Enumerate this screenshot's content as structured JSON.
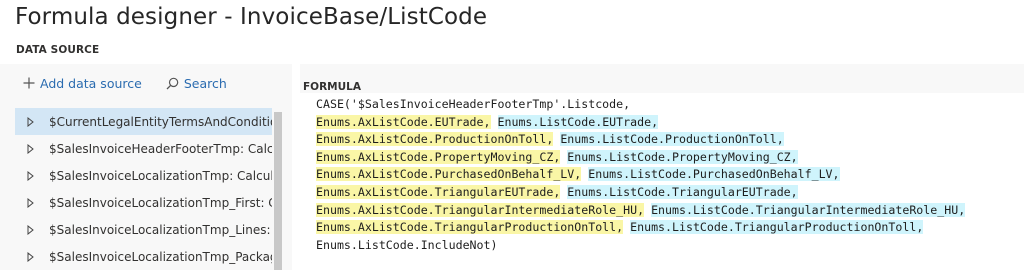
{
  "title": "Formula designer - InvoiceBase/ListCode",
  "data_source_label": "DATA SOURCE",
  "toolbar": {
    "add_label": "Add data source",
    "search_label": "Search",
    "add_icon": "plus-icon",
    "search_icon": "search-icon"
  },
  "tree_items": [
    {
      "label": "$CurrentLegalEntityTermsAndCondition",
      "selected": true
    },
    {
      "label": "$SalesInvoiceHeaderFooterTmp: Calcula"
    },
    {
      "label": "$SalesInvoiceLocalizationTmp: Calculate"
    },
    {
      "label": "$SalesInvoiceLocalizationTmp_First: Cal"
    },
    {
      "label": "$SalesInvoiceLocalizationTmp_Lines: Ca"
    },
    {
      "label": "$SalesInvoiceLocalizationTmp_Package:"
    }
  ],
  "formula": {
    "label": "FORMULA",
    "line0": "CASE('$SalesInvoiceHeaderFooterTmp'.Listcode,",
    "pairs": [
      {
        "a": "Enums.AxListCode.EUTrade",
        "b": "Enums.ListCode.EUTrade"
      },
      {
        "a": "Enums.AxListCode.ProductionOnToll",
        "b": "Enums.ListCode.ProductionOnToll"
      },
      {
        "a": "Enums.AxListCode.PropertyMoving_CZ",
        "b": "Enums.ListCode.PropertyMoving_CZ"
      },
      {
        "a": "Enums.AxListCode.PurchasedOnBehalf_LV",
        "b": "Enums.ListCode.PurchasedOnBehalf_LV"
      },
      {
        "a": "Enums.AxListCode.TriangularEUTrade",
        "b": "Enums.ListCode.TriangularEUTrade"
      },
      {
        "a": "Enums.AxListCode.TriangularIntermediateRole_HU",
        "b": "Enums.ListCode.TriangularIntermediateRole_HU"
      },
      {
        "a": "Enums.AxListCode.TriangularProductionOnToll",
        "b": "Enums.ListCode.TriangularProductionOnToll"
      }
    ],
    "last_line": "Enums.ListCode.IncludeNot)"
  },
  "colors": {
    "selected_row": "#d3e6f5",
    "highlight_yellow": "#faf6a6",
    "highlight_cyan": "#cff4fc",
    "link_blue": "#2b6cb0"
  }
}
